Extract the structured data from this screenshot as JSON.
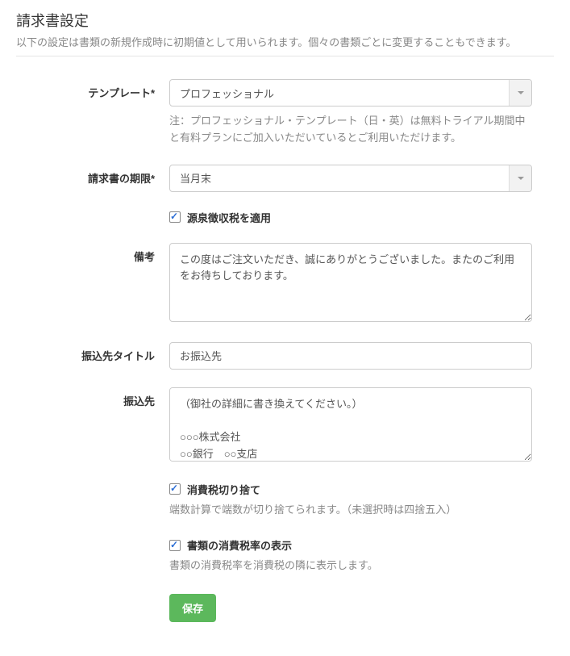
{
  "header": {
    "title": "請求書設定",
    "description": "以下の設定は書類の新規作成時に初期値として用いられます。個々の書類ごとに変更することもできます。"
  },
  "form": {
    "template": {
      "label": "テンプレート*",
      "value": "プロフェッショナル",
      "help": "注：プロフェッショナル・テンプレート（日・英）は無料トライアル期間中と有料プランにご加入いただいているとご利用いただけます。"
    },
    "due": {
      "label": "請求書の期限*",
      "value": "当月末"
    },
    "withholding": {
      "label": "源泉徴収税を適用",
      "checked": true
    },
    "notes": {
      "label": "備考",
      "value": "この度はご注文いただき、誠にありがとうございました。またのご利用をお待ちしております。"
    },
    "bank_title": {
      "label": "振込先タイトル",
      "value": "お振込先"
    },
    "bank": {
      "label": "振込先",
      "value": "（御社の詳細に書き換えてください。）\n\n○○○株式会社\n○○銀行　○○支店"
    },
    "tax_truncate": {
      "label": "消費税切り捨て",
      "desc": "端数計算で端数が切り捨てられます。（未選択時は四捨五入）",
      "checked": true
    },
    "tax_display": {
      "label": "書類の消費税率の表示",
      "desc": "書類の消費税率を消費税の隣に表示します。",
      "checked": true
    },
    "save_label": "保存"
  }
}
